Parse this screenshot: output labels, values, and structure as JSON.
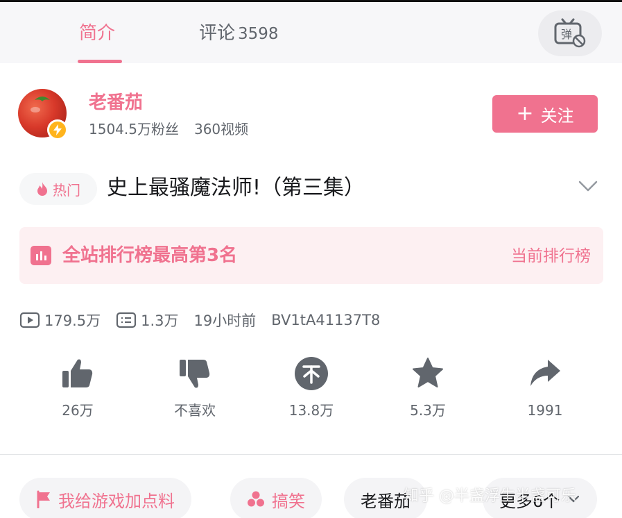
{
  "tabs": {
    "intro": "简介",
    "comments": "评论",
    "comments_count": "3598"
  },
  "danmaku_button": {
    "icon": "danmaku-off-icon",
    "glyph": "弹"
  },
  "uploader": {
    "name": "老番茄",
    "fans": "1504.5万粉丝",
    "videos": "360视频",
    "follow_label": "关注",
    "follow_icon": "plus-icon"
  },
  "video": {
    "hot_tag": "热门",
    "title": "史上最骚魔法师!（第三集）"
  },
  "rank": {
    "text": "全站排行榜最高第3名",
    "link": "当前排行榜"
  },
  "meta": {
    "views": "179.5万",
    "danmaku": "1.3万",
    "time": "19小时前",
    "bvid": "BV1tA41137T8"
  },
  "actions": [
    {
      "label": "26万",
      "icon": "like-icon"
    },
    {
      "label": "不喜欢",
      "icon": "dislike-icon"
    },
    {
      "label": "13.8万",
      "icon": "coin-icon"
    },
    {
      "label": "5.3万",
      "icon": "favorite-icon"
    },
    {
      "label": "1991",
      "icon": "share-icon"
    }
  ],
  "tags": [
    {
      "label": "我给游戏加点料",
      "icon": "flag-icon"
    },
    {
      "label": "搞笑",
      "icon": "funny-icon"
    },
    {
      "label": "老番茄"
    },
    {
      "label": "更多6个"
    }
  ],
  "watermark": "知乎 @半盏浮生半盏可乐",
  "colors": {
    "accent": "#f0728f",
    "text": "#18191c",
    "secondary_text": "#61666d",
    "rank_bg": "#fdf0f2",
    "chip_bg": "#f4f4f6"
  }
}
